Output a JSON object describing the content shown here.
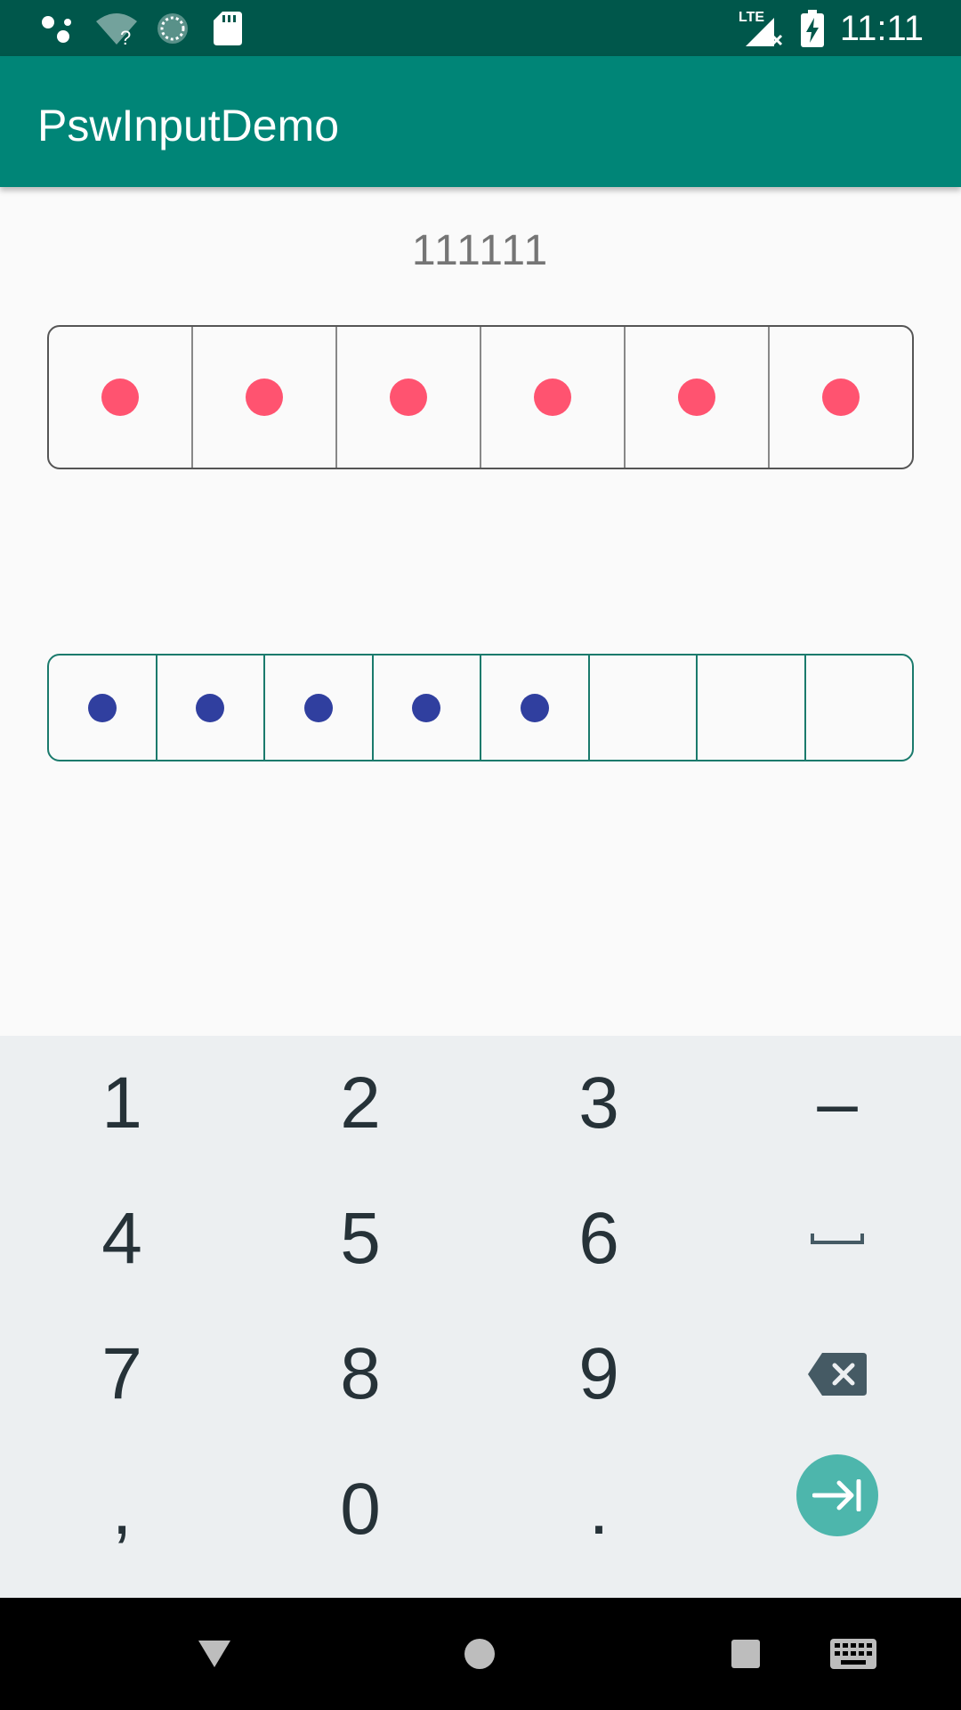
{
  "status_bar": {
    "time": "11:11",
    "icons": [
      "assistant-icon",
      "wifi-unknown-icon",
      "sync-icon",
      "sd-card-icon",
      "lte-no-signal-icon",
      "battery-charging-icon"
    ],
    "network_label": "LTE"
  },
  "app_bar": {
    "title": "PswInputDemo"
  },
  "password_display": "111111",
  "pin_input_1": {
    "length": 6,
    "filled": 6,
    "dot_color": "#ff5370",
    "border_color": "#555555"
  },
  "pin_input_2": {
    "length": 8,
    "filled": 5,
    "dot_color": "#303f9f",
    "border_color": "#1a7a6c"
  },
  "keyboard": {
    "rows": [
      [
        "1",
        "2",
        "3",
        "–"
      ],
      [
        "4",
        "5",
        "6",
        "space"
      ],
      [
        "7",
        "8",
        "9",
        "backspace"
      ],
      [
        ",",
        "0",
        ".",
        "enter"
      ]
    ],
    "keys": {
      "k1": "1",
      "k2": "2",
      "k3": "3",
      "dash": "–",
      "k4": "4",
      "k5": "5",
      "k6": "6",
      "k7": "7",
      "k8": "8",
      "k9": "9",
      "comma": ",",
      "k0": "0",
      "period": "."
    },
    "enter_color": "#4db6ac"
  },
  "nav_bar": {
    "buttons": [
      "back-icon",
      "home-icon",
      "recents-icon",
      "keyboard-switch-icon"
    ]
  }
}
